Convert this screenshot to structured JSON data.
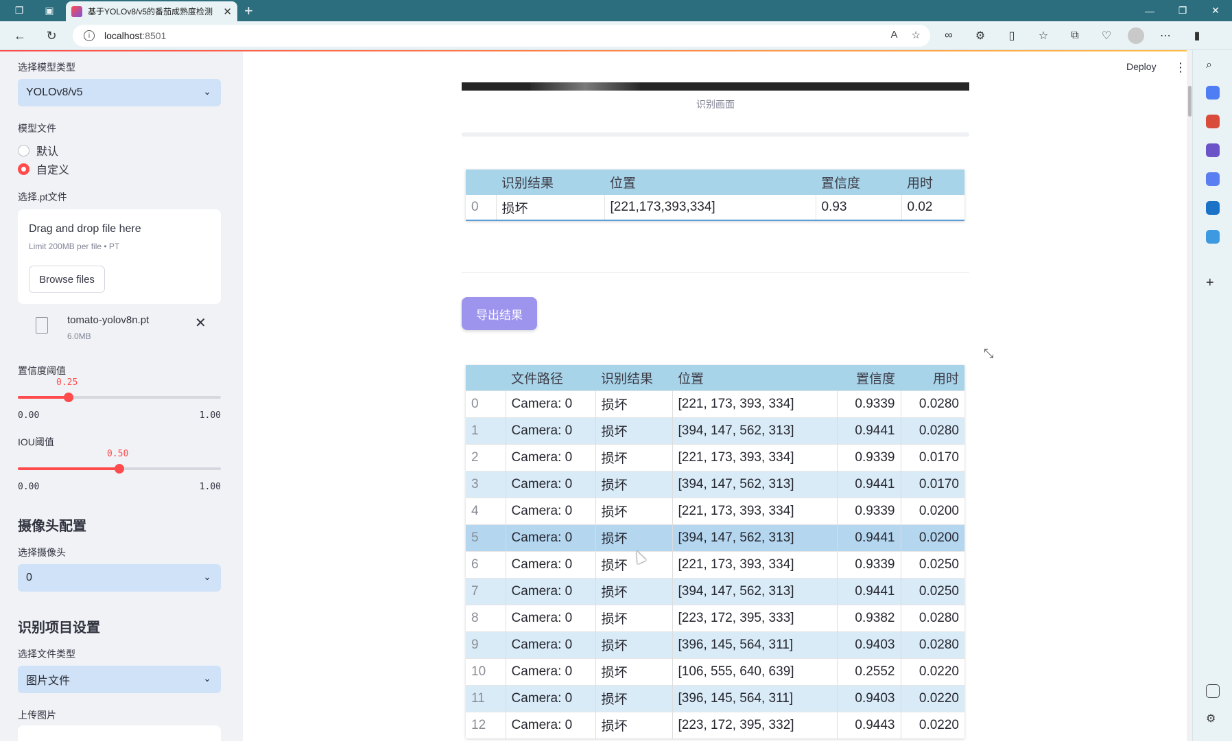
{
  "browser": {
    "tab_title": "基于YOLOv8/v5的番茄成熟度检测",
    "url_host": "localhost",
    "url_port": ":8501",
    "new_tab": "+",
    "close_tab": "✕"
  },
  "app": {
    "deploy_label": "Deploy"
  },
  "sidebar": {
    "model_type_label": "选择模型类型",
    "model_type_value": "YOLOv8/v5",
    "model_file_label": "模型文件",
    "radio_default": "默认",
    "radio_custom": "自定义",
    "pt_label": "选择.pt文件",
    "drag_text": "Drag and drop file here",
    "limit_text": "Limit 200MB per file • PT",
    "browse_label": "Browse files",
    "file_name": "tomato-yolov8n.pt",
    "file_size": "6.0MB",
    "conf_label": "置信度阈值",
    "conf_value": "0.25",
    "conf_fraction": 0.25,
    "iou_label": "IOU阈值",
    "iou_value": "0.50",
    "iou_fraction": 0.5,
    "slider_min": "0.00",
    "slider_max": "1.00",
    "camera_header": "摄像头配置",
    "camera_label": "选择摄像头",
    "camera_value": "0",
    "project_header": "识别项目设置",
    "file_type_label": "选择文件类型",
    "file_type_value": "图片文件",
    "upload_image_label": "上传图片"
  },
  "main": {
    "image_caption": "识别画面",
    "result_table": {
      "headers": [
        "",
        "识别结果",
        "位置",
        "置信度",
        "用时"
      ],
      "rows": [
        [
          "0",
          "损坏",
          "[221,173,393,334]",
          "0.93",
          "0.02"
        ]
      ]
    },
    "export_label": "导出结果",
    "detail_table": {
      "headers": [
        "",
        "文件路径",
        "识别结果",
        "位置",
        "置信度",
        "用时"
      ],
      "rows": [
        [
          "0",
          "Camera: 0",
          "损坏",
          "[221, 173, 393, 334]",
          "0.9339",
          "0.0280"
        ],
        [
          "1",
          "Camera: 0",
          "损坏",
          "[394, 147, 562, 313]",
          "0.9441",
          "0.0280"
        ],
        [
          "2",
          "Camera: 0",
          "损坏",
          "[221, 173, 393, 334]",
          "0.9339",
          "0.0170"
        ],
        [
          "3",
          "Camera: 0",
          "损坏",
          "[394, 147, 562, 313]",
          "0.9441",
          "0.0170"
        ],
        [
          "4",
          "Camera: 0",
          "损坏",
          "[221, 173, 393, 334]",
          "0.9339",
          "0.0200"
        ],
        [
          "5",
          "Camera: 0",
          "损坏",
          "[394, 147, 562, 313]",
          "0.9441",
          "0.0200"
        ],
        [
          "6",
          "Camera: 0",
          "损坏",
          "[221, 173, 393, 334]",
          "0.9339",
          "0.0250"
        ],
        [
          "7",
          "Camera: 0",
          "损坏",
          "[394, 147, 562, 313]",
          "0.9441",
          "0.0250"
        ],
        [
          "8",
          "Camera: 0",
          "损坏",
          "[223, 172, 395, 333]",
          "0.9382",
          "0.0280"
        ],
        [
          "9",
          "Camera: 0",
          "损坏",
          "[396, 145, 564, 311]",
          "0.9403",
          "0.0280"
        ],
        [
          "10",
          "Camera: 0",
          "损坏",
          "[106, 555, 640, 639]",
          "0.2552",
          "0.0220"
        ],
        [
          "11",
          "Camera: 0",
          "损坏",
          "[396, 145, 564, 311]",
          "0.9403",
          "0.0220"
        ],
        [
          "12",
          "Camera: 0",
          "损坏",
          "[223, 172, 395, 332]",
          "0.9443",
          "0.0220"
        ]
      ]
    }
  },
  "colors": {
    "accent": "#ff4b4b",
    "header_blue": "#a8d4ea",
    "row_alt": "#d9ebf7",
    "export_button": "#9d94ee",
    "select_bg": "#cfe2f7"
  }
}
